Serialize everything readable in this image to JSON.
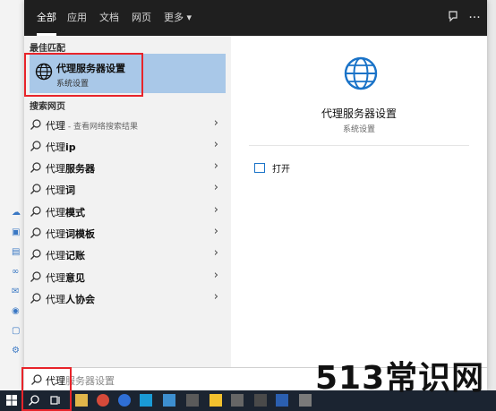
{
  "tabs": [
    {
      "label": "全部",
      "active": true
    },
    {
      "label": "应用",
      "active": false
    },
    {
      "label": "文档",
      "active": false
    },
    {
      "label": "网页",
      "active": false
    },
    {
      "label": "更多 ▾",
      "active": false
    }
  ],
  "toolbar_icons": [
    "feedback-icon",
    "more-options-icon"
  ],
  "best_match": {
    "section_title": "最佳匹配",
    "title": "代理服务器设置",
    "subtitle": "系统设置",
    "icon": "globe-icon"
  },
  "web": {
    "section_title": "搜索网页",
    "items": [
      {
        "prefix": "代理",
        "bold": "",
        "suffix": " - 查看网络搜索结果"
      },
      {
        "prefix": "代理",
        "bold": "ip",
        "suffix": ""
      },
      {
        "prefix": "代理",
        "bold": "服务器",
        "suffix": ""
      },
      {
        "prefix": "代理",
        "bold": "词",
        "suffix": ""
      },
      {
        "prefix": "代理",
        "bold": "模式",
        "suffix": ""
      },
      {
        "prefix": "代理",
        "bold": "词模板",
        "suffix": ""
      },
      {
        "prefix": "代理",
        "bold": "记账",
        "suffix": ""
      },
      {
        "prefix": "代理",
        "bold": "意见",
        "suffix": ""
      },
      {
        "prefix": "代理",
        "bold": "人协会",
        "suffix": ""
      }
    ]
  },
  "detail": {
    "title": "代理服务器设置",
    "subtitle": "系统设置",
    "open_label": "打开"
  },
  "search": {
    "typed": "代理",
    "suggestion": "服务器设置"
  },
  "watermark": "513常识网",
  "colors": {
    "accent": "#1a73c8",
    "selection": "#a9c8e8",
    "highlight_box": "#e8242a",
    "topbar": "#1f1f1f",
    "taskbar": "#1b2431"
  }
}
